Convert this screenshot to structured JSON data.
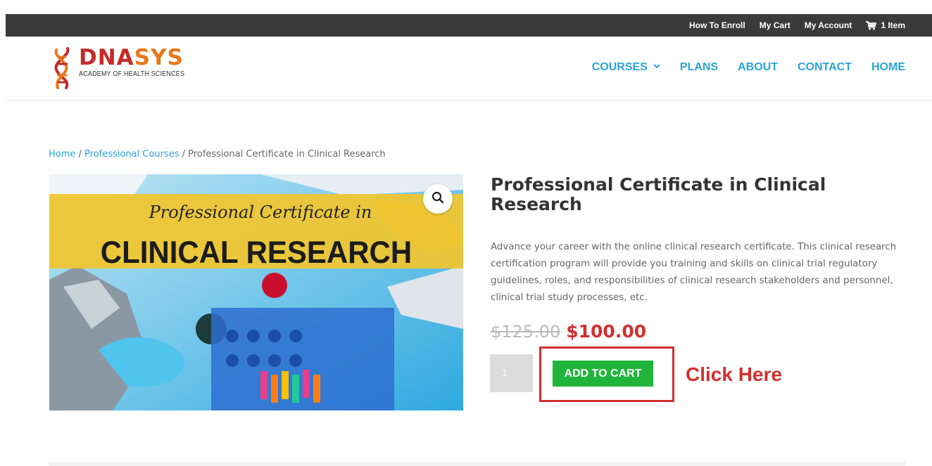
{
  "topbar": {
    "links": [
      {
        "label": "How To Enroll"
      },
      {
        "label": "My Cart"
      },
      {
        "label": "My Account"
      }
    ],
    "cart": {
      "label": "1 Item",
      "icon": "shopping-cart-icon"
    }
  },
  "logo": {
    "brand_part1": "DNA",
    "brand_part2": "SYS",
    "tagline": "ACADEMY OF HEALTH SCIENCES"
  },
  "nav": {
    "items": [
      {
        "label": "COURSES",
        "dropdown": true
      },
      {
        "label": "PLANS"
      },
      {
        "label": "ABOUT"
      },
      {
        "label": "CONTACT"
      },
      {
        "label": "HOME"
      }
    ],
    "color": "#2aa4db"
  },
  "breadcrumb": {
    "home": "Home",
    "separator": " / ",
    "category": "Professional Courses",
    "current": "Professional Certificate in Clinical Research"
  },
  "product": {
    "image": {
      "script_line": "Professional Certificate in",
      "headline": "CLINICAL RESEARCH"
    },
    "title": "Professional Certificate in Clinical Research",
    "description": "Advance your career with the online clinical research certificate. This clinical research certification program will provide you training and skills on clinical trial regulatory guidelines, roles, and responsibilities of clinical research stakeholders and personnel, clinical trial study processes, etc.",
    "price_old": "$125.00",
    "price_new": "$100.00",
    "quantity": "1",
    "add_to_cart_label": "ADD TO CART"
  },
  "annotation": {
    "label": "Click Here",
    "color": "#d32f2f"
  },
  "colors": {
    "topbar": "#3a3a3a",
    "accent": "#2aa4db",
    "button": "#20b53a",
    "price": "#d32f2f"
  }
}
